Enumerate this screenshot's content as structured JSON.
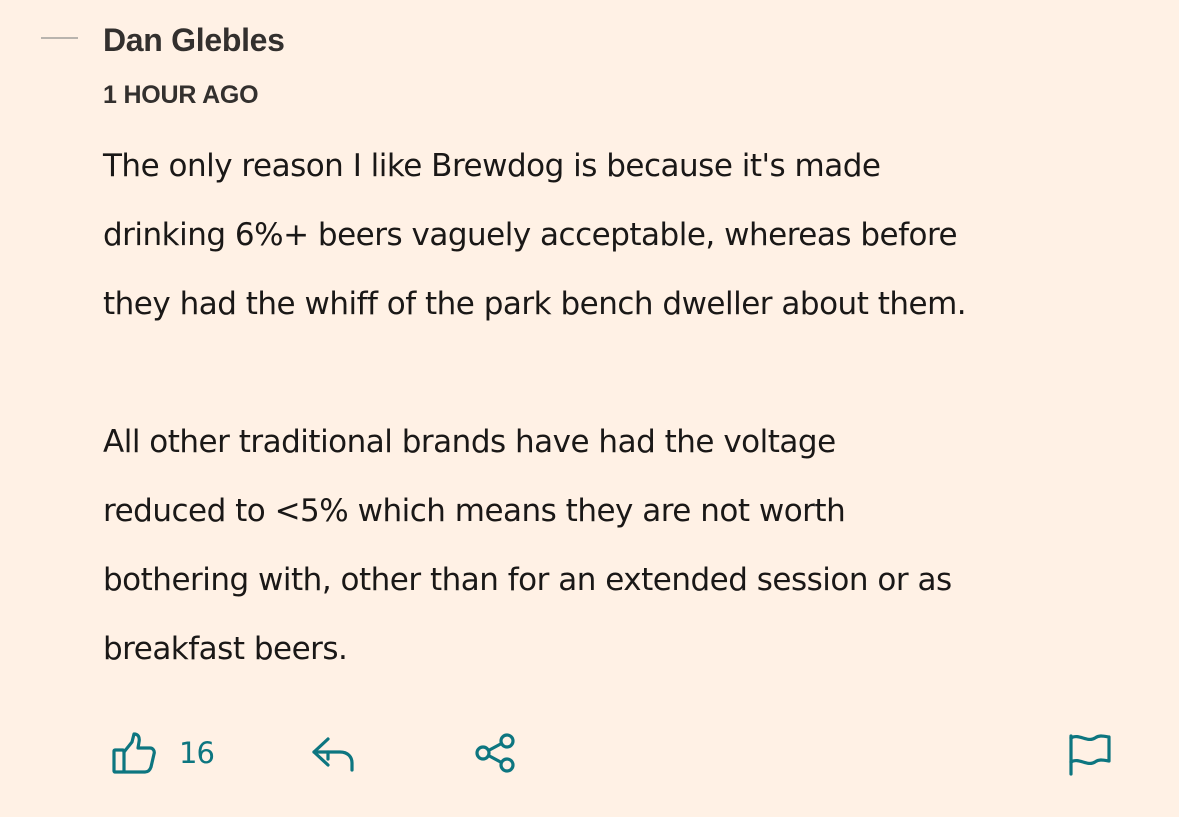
{
  "comment": {
    "author": "Dan Glebles",
    "timestamp": "1 HOUR AGO",
    "paragraphs": [
      "The only reason I like Brewdog is because it's made\ndrinking 6%+ beers vaguely acceptable, whereas before\nthey had the whiff of the park bench dweller about them.",
      "All other traditional brands have had the voltage\nreduced to <5% which means they are not worth\nbothering with, other than for an extended session or as\nbreakfast beers."
    ],
    "actions": {
      "like_count": "16",
      "like_icon": "thumbs-up-icon",
      "reply_icon": "reply-icon",
      "share_icon": "share-icon",
      "flag_icon": "flag-icon"
    }
  },
  "colors": {
    "background": "#fff1e5",
    "accent": "#0d7680",
    "text": "#1a1817"
  }
}
